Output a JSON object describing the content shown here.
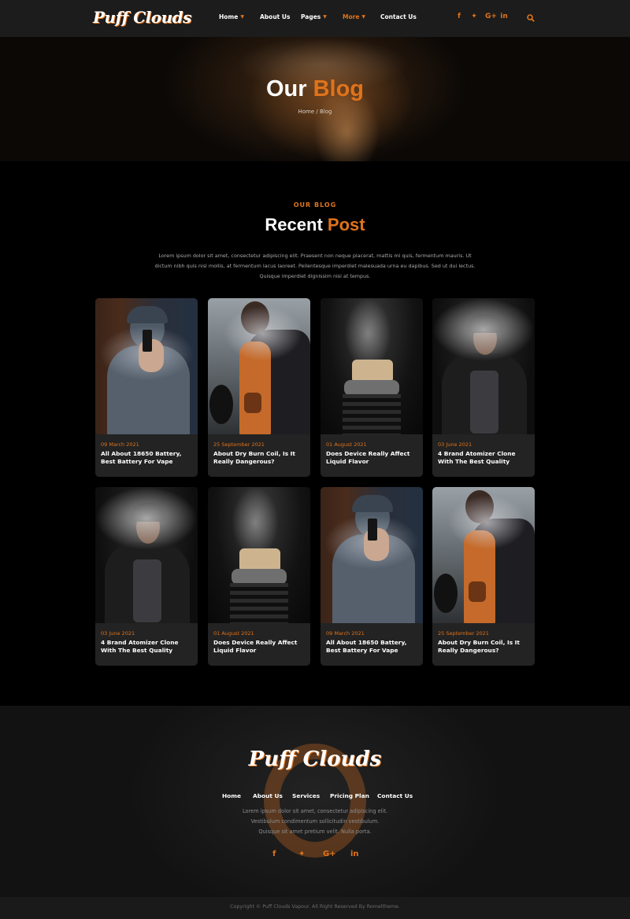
{
  "brand": {
    "logo_text": "Puff Clouds",
    "accent_color": "#e0731a"
  },
  "nav": {
    "items": [
      {
        "label": "Home",
        "has_dropdown": true,
        "active": false
      },
      {
        "label": "About Us",
        "has_dropdown": false,
        "active": false
      },
      {
        "label": "Pages",
        "has_dropdown": true,
        "active": false
      },
      {
        "label": "More",
        "has_dropdown": true,
        "active": true
      },
      {
        "label": "Contact Us",
        "has_dropdown": false,
        "active": false
      }
    ],
    "social_icons": [
      "facebook-icon",
      "twitter-icon",
      "google-plus-icon",
      "linkedin-icon"
    ],
    "search_icon": "search-icon"
  },
  "hero": {
    "title_part1": "Our",
    "title_part2": "Blog",
    "breadcrumb": "Home / Blog"
  },
  "section": {
    "kicker": "OUR BLOG",
    "title_part1": "Recent",
    "title_part2": "Post",
    "intro": "Lorem ipsum dolor sit amet, consectetur adipiscing elit. Praesent non neque placerat, mattis mi quis, fermentum mauris. Ut dictum nibh quis nisl mollis, at fermentum lacus laoreet. Pellentesque imperdiet malesuada urna eu dapibus. Sed ut dui lectus. Quisque imperdiet dignissim nisi at tempus."
  },
  "posts": [
    {
      "date": "09 March 2021",
      "title": "All About 18650 Battery, Best Battery For Vape",
      "image": "man-vaping"
    },
    {
      "date": "25 September 2021",
      "title": "About Dry Burn Coil, Is It Really Dangerous?",
      "image": "woman-vaping"
    },
    {
      "date": "01 August 2021",
      "title": "Does Device Really Affect Liquid Flavor",
      "image": "atomizer-closeup"
    },
    {
      "date": "03 June 2021",
      "title": "4 Brand Atomizer Clone With The Best Quality",
      "image": "hooded-man-vaping"
    },
    {
      "date": "03 June 2021",
      "title": "4 Brand Atomizer Clone With The Best Quality",
      "image": "hooded-man-vaping"
    },
    {
      "date": "01 August 2021",
      "title": "Does Device Really Affect Liquid Flavor",
      "image": "atomizer-closeup"
    },
    {
      "date": "09 March 2021",
      "title": "All About 18650 Battery, Best Battery For Vape",
      "image": "man-vaping"
    },
    {
      "date": "25 September 2021",
      "title": "About Dry Burn Coil, Is It Really Dangerous?",
      "image": "woman-vaping"
    }
  ],
  "footer": {
    "logo_text": "Puff Clouds",
    "nav": [
      "Home",
      "About Us",
      "Services",
      "Pricing Plan",
      "Contact Us"
    ],
    "text": "Lorem ipsum dolor sit amet, consectetur adipiscing elit. Vestibulum condimentum sollicitudin vestibulum. Quisque sit amet pretium velit. Nulla porta.",
    "social_icons": [
      "facebook-icon",
      "twitter-icon",
      "google-plus-icon",
      "linkedin-icon"
    ],
    "copyright": "Copyright © Puff Clouds Vapour. All Right Reserved By Romeltheme."
  }
}
